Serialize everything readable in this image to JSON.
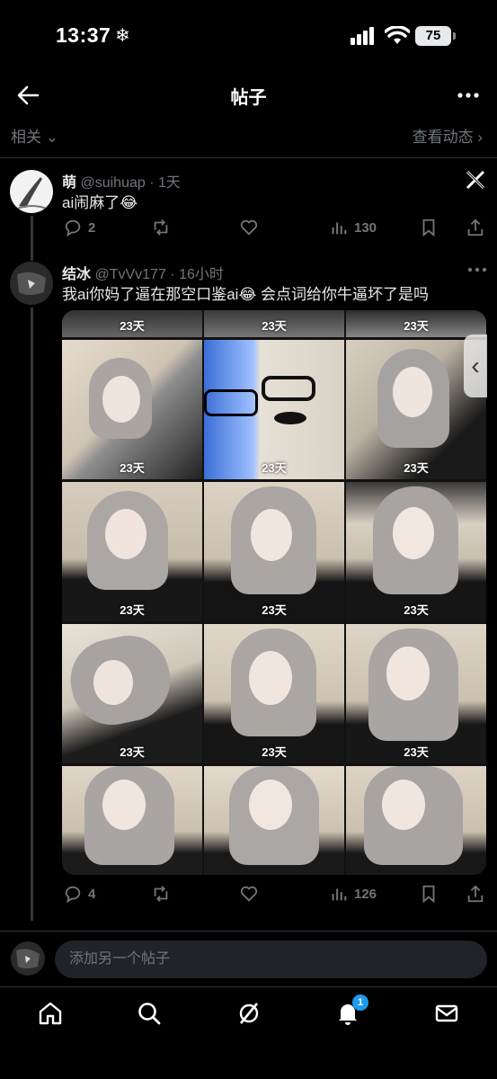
{
  "status": {
    "time": "13:37",
    "battery": "75"
  },
  "header": {
    "title": "帖子"
  },
  "subnav": {
    "left": "相关",
    "right": "查看动态"
  },
  "post1": {
    "name": "萌",
    "handle": "@suihuap",
    "dot": "·",
    "age": "1天",
    "text": "ai闹麻了😂",
    "replies": "2",
    "views": "130"
  },
  "post2": {
    "name": "结冰",
    "handle": "@TvVv177",
    "dot": "·",
    "age": "16小时",
    "text": "我ai你妈了逼在那空口鉴ai😂 会点词给你牛逼坏了是吗",
    "replies": "4",
    "views": "126",
    "image_label": "23天"
  },
  "reply": {
    "placeholder": "添加另一个帖子"
  },
  "nav": {
    "notification_count": "1"
  },
  "colors": {
    "accent": "#1d9bf0",
    "background": "#000000",
    "muted": "#71767b"
  }
}
